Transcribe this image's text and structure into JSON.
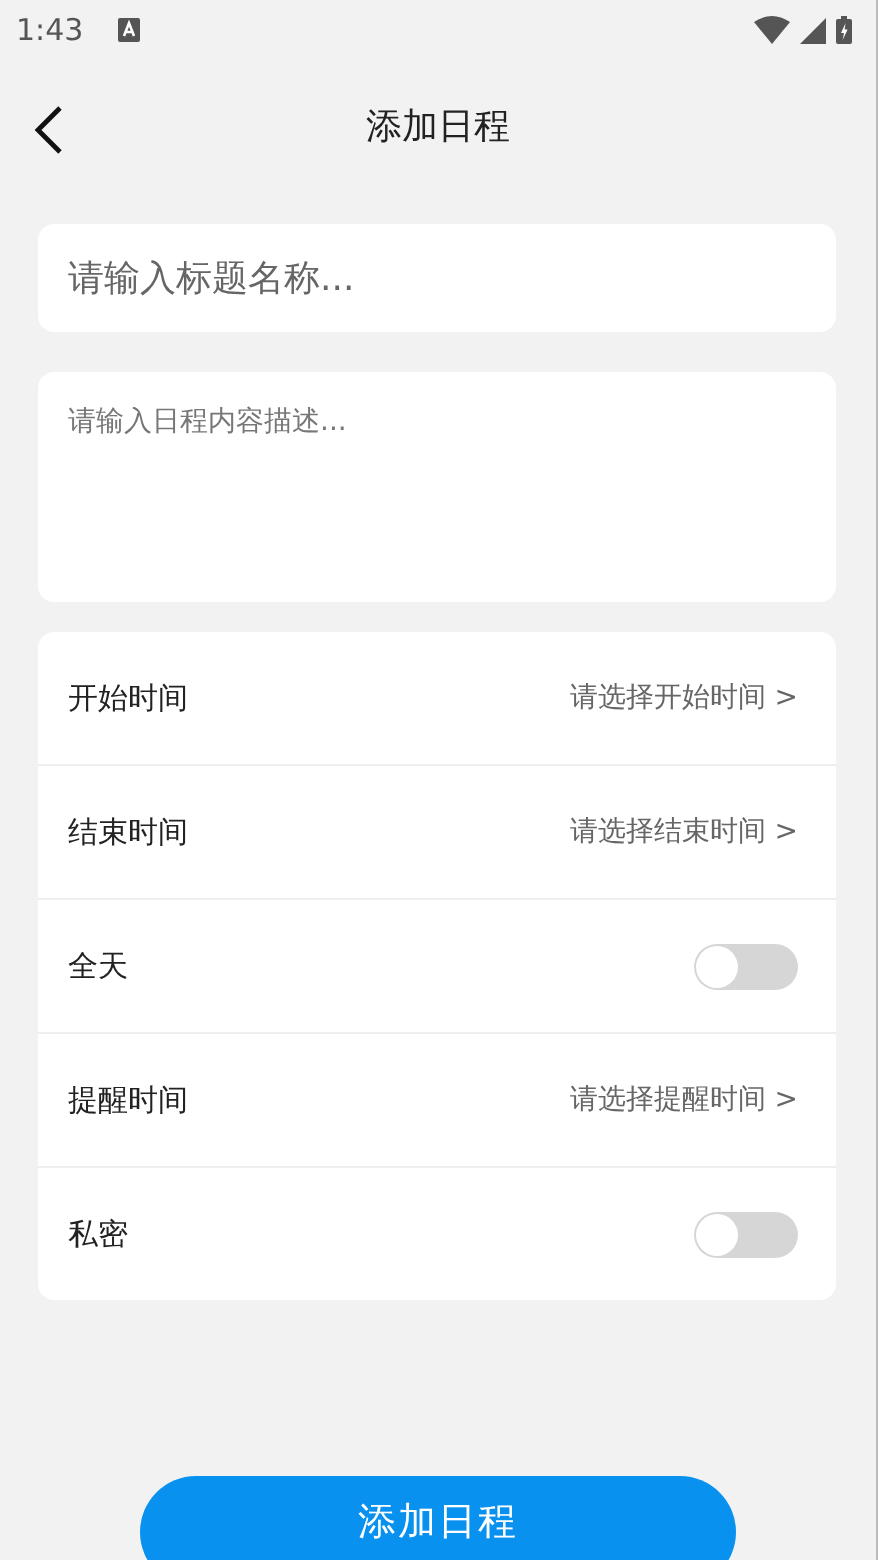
{
  "status_bar": {
    "time": "1:43"
  },
  "header": {
    "title": "添加日程"
  },
  "title_field": {
    "placeholder": "请输入标题名称..."
  },
  "description_field": {
    "placeholder": "请输入日程内容描述..."
  },
  "settings": [
    {
      "kind": "picker",
      "label": "开始时间",
      "value": "请选择开始时间 >"
    },
    {
      "kind": "picker",
      "label": "结束时间",
      "value": "请选择结束时间 >"
    },
    {
      "kind": "toggle",
      "label": "全天",
      "on": false
    },
    {
      "kind": "picker",
      "label": "提醒时间",
      "value": "请选择提醒时间 >"
    },
    {
      "kind": "toggle",
      "label": "私密",
      "on": false
    }
  ],
  "submit_button": {
    "label": "添加日程"
  }
}
